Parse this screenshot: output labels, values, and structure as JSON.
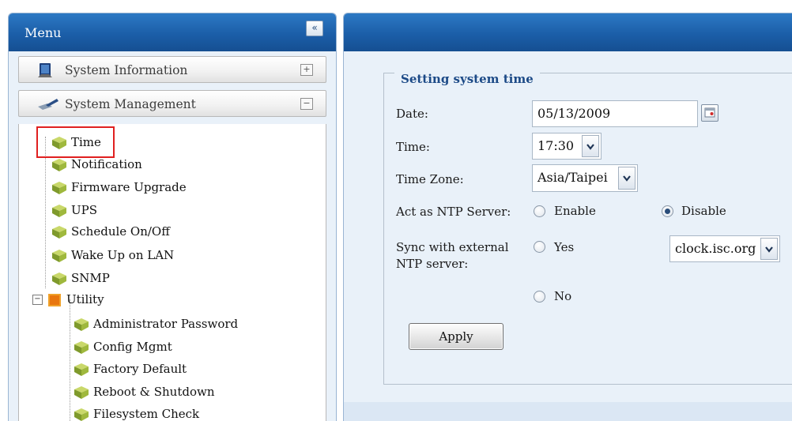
{
  "menu": {
    "title": "Menu",
    "collapse_label": "«",
    "sections": [
      {
        "label": "System Information",
        "toggle": "+"
      },
      {
        "label": "System Management",
        "toggle": "−"
      }
    ],
    "items": [
      {
        "label": "Time"
      },
      {
        "label": "Notification"
      },
      {
        "label": "Firmware Upgrade"
      },
      {
        "label": "UPS"
      },
      {
        "label": "Schedule On/Off"
      },
      {
        "label": "Wake Up on LAN"
      },
      {
        "label": "SNMP"
      }
    ],
    "utility": {
      "label": "Utility",
      "expander": "−",
      "children": [
        {
          "label": "Administrator Password"
        },
        {
          "label": "Config Mgmt"
        },
        {
          "label": "Factory Default"
        },
        {
          "label": "Reboot & Shutdown"
        },
        {
          "label": "Filesystem Check"
        }
      ]
    }
  },
  "form": {
    "legend": "Setting system time",
    "date_label": "Date:",
    "date_value": "05/13/2009",
    "time_label": "Time:",
    "time_value": "17:30",
    "tz_label": "Time Zone:",
    "tz_value": "Asia/Taipei",
    "ntp_label": "Act as NTP Server:",
    "ntp_enable": "Enable",
    "ntp_disable": "Disable",
    "sync_label_1": "Sync with external",
    "sync_label_2": "NTP server:",
    "sync_yes": "Yes",
    "sync_no": "No",
    "ntp_server_value": "clock.isc.org",
    "apply_label": "Apply"
  },
  "colors": {
    "header_blue": "#1b5ea8",
    "panel_bg": "#e9f1f9",
    "highlight_red": "#e02020",
    "legend_blue": "#1c4a87"
  }
}
